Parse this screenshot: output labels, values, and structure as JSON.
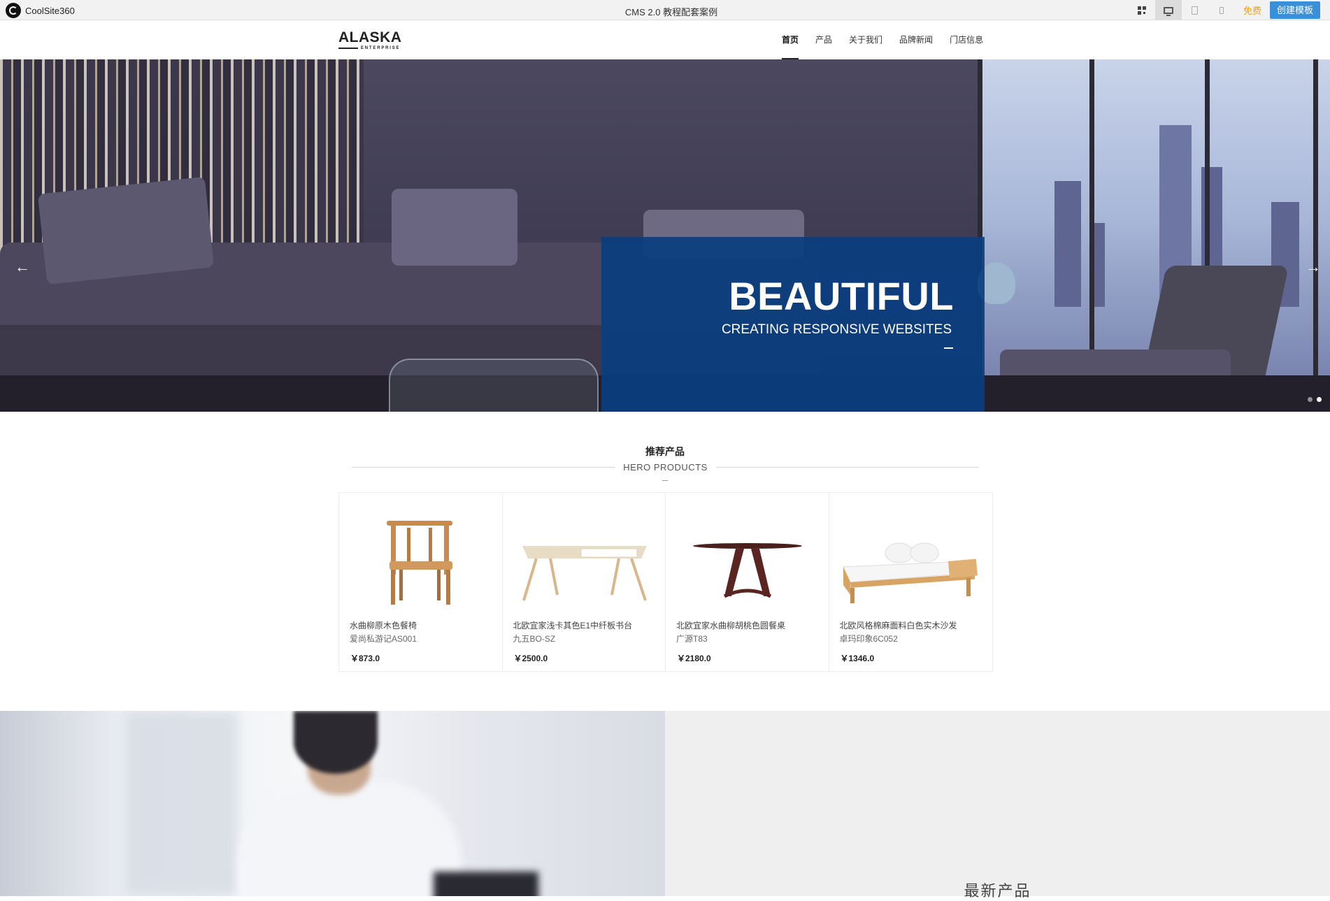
{
  "app": {
    "brand": "CoolSite360",
    "window_title": "CMS 2.0 教程配套案例",
    "free_label": "免费",
    "create_label": "创建模板",
    "tools": [
      "qr-code-icon",
      "desktop-icon",
      "tablet-icon",
      "phone-icon"
    ]
  },
  "site": {
    "logo_name": "ALASKA",
    "logo_sub": "ENTERPRISE",
    "nav": [
      {
        "label": "首页",
        "active": true
      },
      {
        "label": "产品",
        "active": false
      },
      {
        "label": "关于我们",
        "active": false
      },
      {
        "label": "品牌新闻",
        "active": false
      },
      {
        "label": "门店信息",
        "active": false
      }
    ]
  },
  "hero": {
    "headline": "BEAUTIFUL",
    "subline": "CREATING RESPONSIVE WEBSITES",
    "slides": 2,
    "active_slide": 2,
    "caption_color": "#0a3e80"
  },
  "products_section": {
    "title": "推荐产品",
    "subtitle": "HERO PRODUCTS",
    "items": [
      {
        "name": "水曲柳原木色餐椅",
        "code": "爱尚私游记AS001",
        "price": "￥873.0",
        "icon": "chair-image"
      },
      {
        "name": "北欧宜家浅卡其色E1中纤板书台",
        "code": "九五BO-SZ",
        "price": "￥2500.0",
        "icon": "desk-image"
      },
      {
        "name": "北欧宜家水曲柳胡桃色圆餐桌",
        "code": "广源T83",
        "price": "￥2180.0",
        "icon": "round-table-image"
      },
      {
        "name": "北欧风格棉麻面料白色实木沙发",
        "code": "卓玛印象6C052",
        "price": "￥1346.0",
        "icon": "sofa-image"
      }
    ]
  },
  "latest_section": {
    "heading": "最新产品"
  }
}
